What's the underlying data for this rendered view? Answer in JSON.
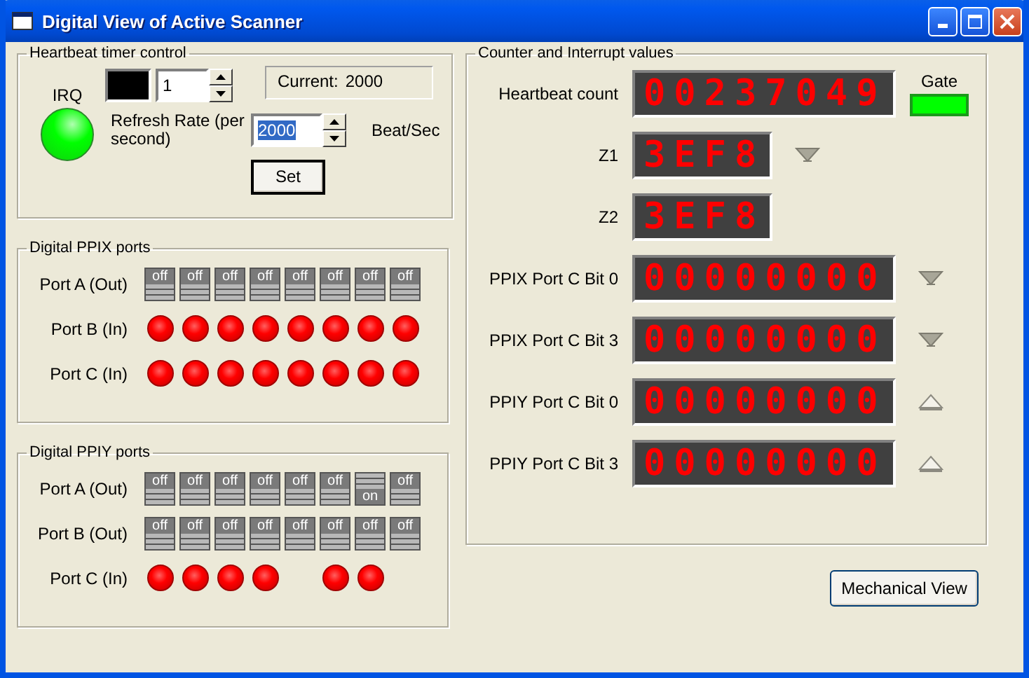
{
  "window": {
    "title": "Digital View of Active Scanner"
  },
  "heartbeat_timer": {
    "title": "Heartbeat timer control",
    "irq": {
      "label": "IRQ",
      "on": true
    },
    "counter_field": {
      "value": "1"
    },
    "current": {
      "label": "Current:",
      "value": "2000"
    },
    "refresh_rate": {
      "label": "Refresh Rate (per second)",
      "value": "2000",
      "value_selected": true,
      "unit": "Beat/Sec"
    },
    "set_button": "Set"
  },
  "ppix": {
    "title": "Digital PPIX ports",
    "ports": [
      {
        "label": "Port A (Out)",
        "kind": "switches",
        "bits": [
          {
            "label": "off",
            "on": false
          },
          {
            "label": "off",
            "on": false
          },
          {
            "label": "off",
            "on": false
          },
          {
            "label": "off",
            "on": false
          },
          {
            "label": "off",
            "on": false
          },
          {
            "label": "off",
            "on": false
          },
          {
            "label": "off",
            "on": false
          },
          {
            "label": "off",
            "on": false
          }
        ]
      },
      {
        "label": "Port B (In)",
        "kind": "leds",
        "bits": [
          {
            "on": true
          },
          {
            "on": true
          },
          {
            "on": true
          },
          {
            "on": true
          },
          {
            "on": true
          },
          {
            "on": true
          },
          {
            "on": true
          },
          {
            "on": true
          }
        ]
      },
      {
        "label": "Port C (In)",
        "kind": "leds",
        "bits": [
          {
            "on": true
          },
          {
            "on": true
          },
          {
            "on": true
          },
          {
            "on": true
          },
          {
            "on": true
          },
          {
            "on": true
          },
          {
            "on": true
          },
          {
            "on": true
          }
        ]
      }
    ]
  },
  "ppiy": {
    "title": "Digital PPIY ports",
    "ports": [
      {
        "label": "Port A (Out)",
        "kind": "switches",
        "bits": [
          {
            "label": "off",
            "on": false
          },
          {
            "label": "off",
            "on": false
          },
          {
            "label": "off",
            "on": false
          },
          {
            "label": "off",
            "on": false
          },
          {
            "label": "off",
            "on": false
          },
          {
            "label": "off",
            "on": false
          },
          {
            "label": "on",
            "on": true
          },
          {
            "label": "off",
            "on": false
          }
        ]
      },
      {
        "label": "Port B (Out)",
        "kind": "switches",
        "bits": [
          {
            "label": "off",
            "on": false
          },
          {
            "label": "off",
            "on": false
          },
          {
            "label": "off",
            "on": false
          },
          {
            "label": "off",
            "on": false
          },
          {
            "label": "off",
            "on": false
          },
          {
            "label": "off",
            "on": false
          },
          {
            "label": "off",
            "on": false
          },
          {
            "label": "off",
            "on": false
          }
        ]
      },
      {
        "label": "Port C (In)",
        "kind": "leds",
        "bits": [
          {
            "on": true
          },
          {
            "on": true
          },
          {
            "on": true
          },
          {
            "on": true
          },
          {
            "on": false
          },
          {
            "on": true
          },
          {
            "on": true
          },
          {
            "on": false
          }
        ]
      }
    ]
  },
  "counters": {
    "title": "Counter and Interrupt values",
    "rows": [
      {
        "label": "Heartbeat count",
        "display": "00237049",
        "gate": {
          "label": "Gate",
          "on": true
        }
      },
      {
        "label": "Z1",
        "display": "3EF8",
        "indicator": {
          "kind": "down"
        }
      },
      {
        "label": "Z2",
        "display": "3EF8"
      },
      {
        "label": "PPIX Port C Bit 0",
        "display": "00000000",
        "indicator": {
          "kind": "down"
        }
      },
      {
        "label": "PPIX Port C Bit 3",
        "display": "00000000",
        "indicator": {
          "kind": "down"
        }
      },
      {
        "label": "PPIY Port C Bit 0",
        "display": "00000000",
        "indicator": {
          "kind": "up"
        }
      },
      {
        "label": "PPIY Port C Bit 3",
        "display": "00000000",
        "indicator": {
          "kind": "up"
        }
      }
    ]
  },
  "buttons": [
    "Mechanical View"
  ]
}
